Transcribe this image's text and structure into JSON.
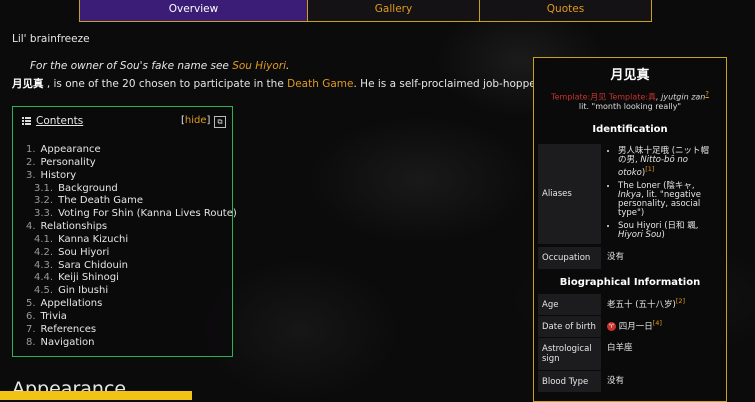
{
  "tabs": {
    "overview": "Overview",
    "gallery": "Gallery",
    "quotes": "Quotes"
  },
  "subtitle": "Lil' brainfreeze",
  "hatnote": {
    "prefix": "For the owner of Sou's fake name see ",
    "link": "Sou Hiyori",
    "suffix": "."
  },
  "intro": {
    "name": "月见真",
    "part1": " , is one of the 20 chosen to participate in the ",
    "link": "Death Game",
    "part2": ". He is a self-proclaimed job-hopper."
  },
  "toc": {
    "title": "Contents",
    "hide_open": "[",
    "hide_label": "hide",
    "hide_close": "]",
    "popout_glyph": "⧉",
    "items": [
      {
        "num": "1.",
        "label": "Appearance",
        "level": 1
      },
      {
        "num": "2.",
        "label": "Personality",
        "level": 1
      },
      {
        "num": "3.",
        "label": "History",
        "level": 1
      },
      {
        "num": "3.1.",
        "label": "Background",
        "level": 2
      },
      {
        "num": "3.2.",
        "label": "The Death Game",
        "level": 2
      },
      {
        "num": "3.3.",
        "label": "Voting For Shin (Kanna Lives Route)",
        "level": 2
      },
      {
        "num": "4.",
        "label": "Relationships",
        "level": 1
      },
      {
        "num": "4.1.",
        "label": "Kanna Kizuchi",
        "level": 2
      },
      {
        "num": "4.2.",
        "label": "Sou Hiyori",
        "level": 2
      },
      {
        "num": "4.3.",
        "label": "Sara Chidouin",
        "level": 2
      },
      {
        "num": "4.4.",
        "label": "Keiji Shinogi",
        "level": 2
      },
      {
        "num": "4.5.",
        "label": "Gin Ibushi",
        "level": 2
      },
      {
        "num": "5.",
        "label": "Appellations",
        "level": 1
      },
      {
        "num": "6.",
        "label": "Trivia",
        "level": 1
      },
      {
        "num": "7.",
        "label": "References",
        "level": 1
      },
      {
        "num": "8.",
        "label": "Navigation",
        "level": 1
      }
    ]
  },
  "section_heading": "Appearance",
  "infobox": {
    "title": "月见真",
    "tpl_red1": "Template:月见 Template:真",
    "tpl_italic": ", jyutgin zan",
    "tpl_sup": "?",
    "tpl_line2": "lit. \"month looking really\"",
    "identification": "Identification",
    "aliases_label": "Aliases",
    "aliases": [
      {
        "text": "男人味十足哦 (ニット帽の男, ",
        "italic": "Nitto-bō no otoko",
        "tail": ")",
        "sup": "[1]"
      },
      {
        "text": "The Loner (陰キャ, ",
        "italic": "Inkya",
        "tail": ", lit. \"negative personality, asocial type\")",
        "sup": ""
      },
      {
        "text": "Sou Hiyori (日和 颯, ",
        "italic": "Hiyori Sou",
        "tail": ")",
        "sup": ""
      }
    ],
    "occupation_label": "Occupation",
    "occupation_value": "没有",
    "bio": "Biographical Information",
    "age_label": "Age",
    "age_value": "老五十 (五十八岁)",
    "age_sup": "[2]",
    "dob_label": "Date of birth",
    "dob_glyph": "♈",
    "dob_value": "四月一日",
    "dob_sup": "[4]",
    "astro_label": "Astrological sign",
    "astro_value": "白羊座",
    "blood_label": "Blood Type",
    "blood_value": "没有"
  }
}
